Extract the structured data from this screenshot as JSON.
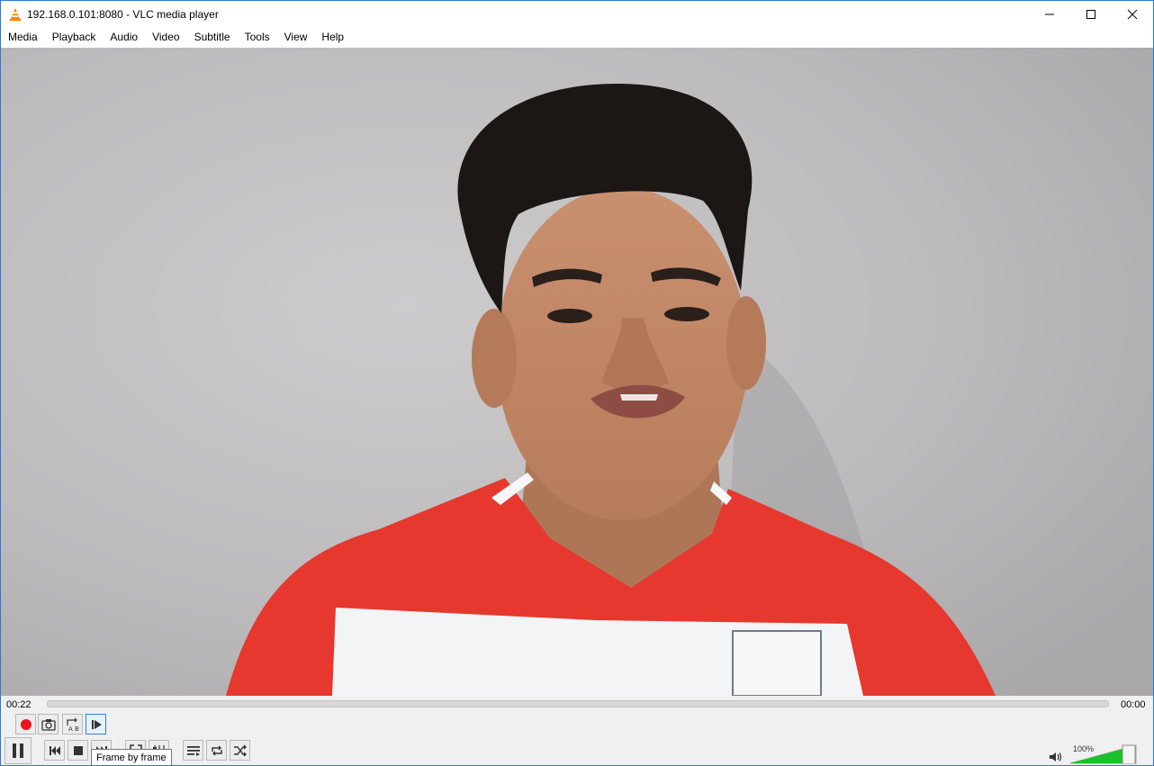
{
  "window": {
    "title": "192.168.0.101:8080 - VLC media player"
  },
  "menu": [
    "Media",
    "Playback",
    "Audio",
    "Video",
    "Subtitle",
    "Tools",
    "View",
    "Help"
  ],
  "player": {
    "current_time": "00:22",
    "total_time": "00:00",
    "volume_label": "100%",
    "volume_level": 1.0,
    "tooltip": "Frame by frame"
  },
  "advanced_controls": [
    {
      "name": "record-button",
      "icon": "record-icon"
    },
    {
      "name": "snapshot-button",
      "icon": "camera-icon"
    },
    {
      "name": "ab-loop-button",
      "icon": "ab-loop-icon"
    },
    {
      "name": "frame-by-frame-button",
      "icon": "frame-step-icon"
    }
  ],
  "main_controls": [
    {
      "name": "pause-button",
      "icon": "pause-icon"
    },
    {
      "name": "previous-button",
      "icon": "previous-icon"
    },
    {
      "name": "stop-button",
      "icon": "stop-icon"
    },
    {
      "name": "next-button",
      "icon": "next-icon"
    },
    {
      "name": "fullscreen-button",
      "icon": "fullscreen-icon"
    },
    {
      "name": "extended-settings-button",
      "icon": "equalizer-icon"
    },
    {
      "name": "playlist-button",
      "icon": "playlist-icon"
    },
    {
      "name": "loop-button",
      "icon": "loop-icon"
    },
    {
      "name": "shuffle-button",
      "icon": "shuffle-icon"
    }
  ],
  "colors": {
    "record": "#e8151c",
    "accent": "#2b79d0",
    "volume_fill": "#19c22a",
    "shirt_red": "#e6382f",
    "shirt_white": "#f2f4f5"
  }
}
